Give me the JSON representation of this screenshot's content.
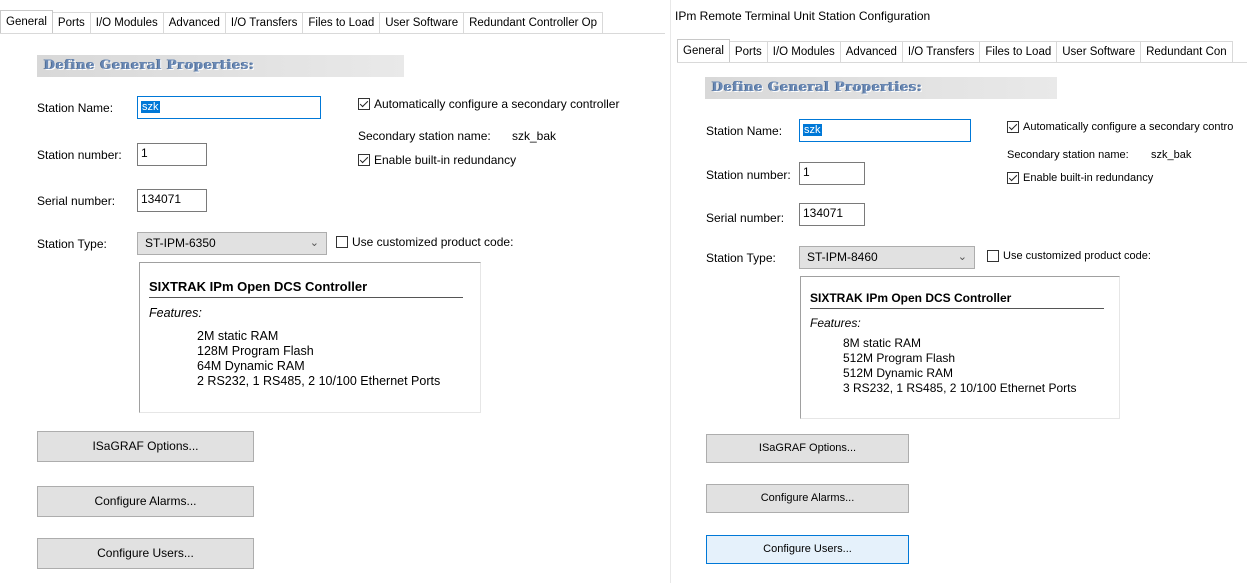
{
  "left": {
    "tabs": [
      "General",
      "Ports",
      "I/O Modules",
      "Advanced",
      "I/O Transfers",
      "Files to Load",
      "User Software",
      "Redundant Controller Op"
    ],
    "section_header": "Define General Properties:",
    "station_name_label": "Station Name:",
    "station_name_value": "szk",
    "station_number_label": "Station number:",
    "station_number_value": "1",
    "serial_number_label": "Serial number:",
    "serial_number_value": "134071",
    "station_type_label": "Station Type:",
    "station_type_value": "ST-IPM-6350",
    "auto_secondary_label": "Automatically configure a secondary controller",
    "auto_secondary_checked": true,
    "secondary_name_label": "Secondary station name:",
    "secondary_name_value": "szk_bak",
    "redundancy_label": "Enable built-in redundancy",
    "redundancy_checked": true,
    "custom_code_label": "Use customized product code:",
    "custom_code_checked": false,
    "product_title": "SIXTRAK IPm Open DCS Controller",
    "features_label": "Features:",
    "features": [
      "2M static RAM",
      "128M Program Flash",
      "64M Dynamic RAM",
      "2 RS232, 1 RS485, 2 10/100 Ethernet Ports"
    ],
    "buttons": {
      "isagraf": "ISaGRAF Options...",
      "alarms": "Configure Alarms...",
      "users": "Configure Users..."
    }
  },
  "right": {
    "window_title": "IPm Remote Terminal Unit Station Configuration",
    "tabs": [
      "General",
      "Ports",
      "I/O Modules",
      "Advanced",
      "I/O Transfers",
      "Files to Load",
      "User Software",
      "Redundant Con"
    ],
    "section_header": "Define General Properties:",
    "station_name_label": "Station Name:",
    "station_name_value": "szk",
    "station_number_label": "Station number:",
    "station_number_value": "1",
    "serial_number_label": "Serial number:",
    "serial_number_value": "134071",
    "station_type_label": "Station Type:",
    "station_type_value": "ST-IPM-8460",
    "auto_secondary_label": "Automatically configure a secondary contro",
    "auto_secondary_checked": true,
    "secondary_name_label": "Secondary station name:",
    "secondary_name_value": "szk_bak",
    "redundancy_label": "Enable built-in redundancy",
    "redundancy_checked": true,
    "custom_code_label": "Use customized product code:",
    "custom_code_checked": false,
    "product_title": "SIXTRAK IPm Open DCS Controller",
    "features_label": "Features:",
    "features": [
      "8M static RAM",
      "512M Program Flash",
      "512M Dynamic RAM",
      "3 RS232, 1 RS485, 2 10/100 Ethernet Ports"
    ],
    "buttons": {
      "isagraf": "ISaGRAF Options...",
      "alarms": "Configure Alarms...",
      "users": "Configure Users..."
    }
  },
  "colors": {
    "accent": "#0078d7",
    "header_text": "#6a89b5",
    "button_face": "#e1e1e1"
  }
}
